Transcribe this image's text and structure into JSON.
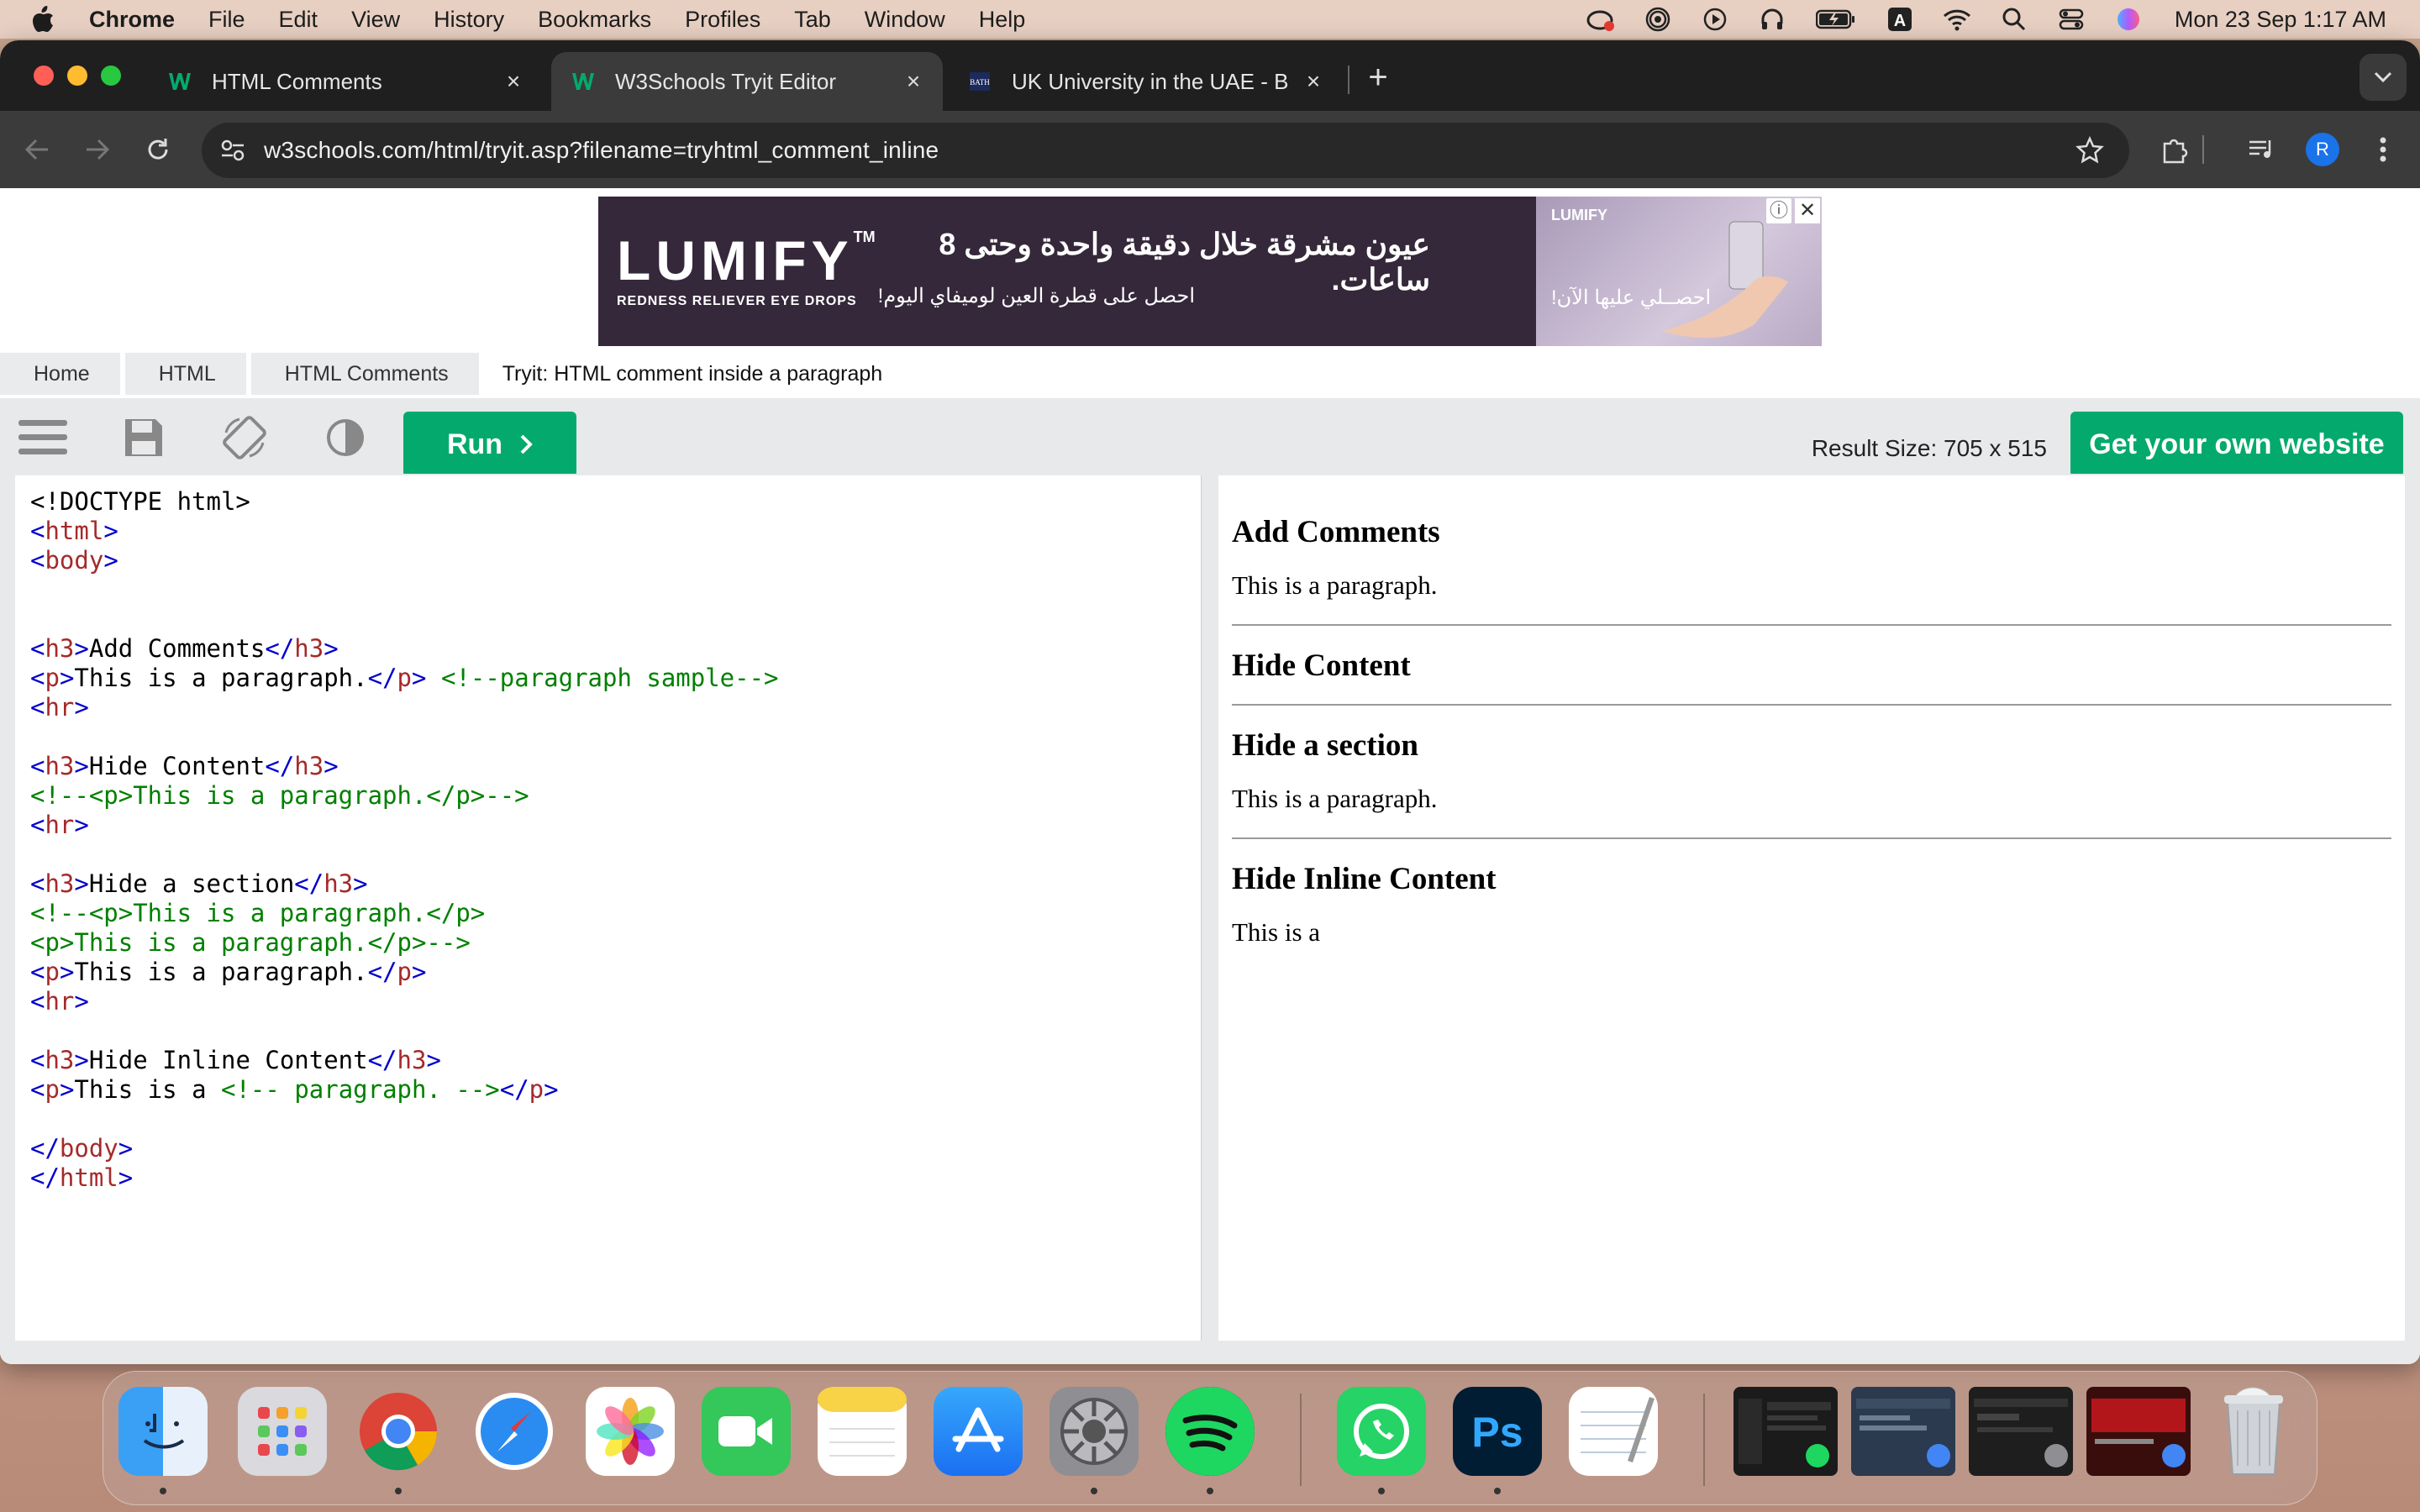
{
  "menubar": {
    "app": "Chrome",
    "items": [
      "File",
      "Edit",
      "View",
      "History",
      "Bookmarks",
      "Profiles",
      "Tab",
      "Window",
      "Help"
    ],
    "clock": "Mon 23 Sep  1:17 AM",
    "status_icons": [
      "creative-cloud-icon",
      "airdrop-icon",
      "play-icon",
      "headphones-icon",
      "battery-icon",
      "keyboard-a-icon",
      "wifi-icon",
      "spotlight-icon",
      "control-center-icon",
      "siri-icon"
    ]
  },
  "browser": {
    "tabs": [
      {
        "title": "HTML Comments",
        "icon": "w3schools-icon"
      },
      {
        "title": "W3Schools Tryit Editor",
        "icon": "w3schools-icon"
      },
      {
        "title": "UK University in the UAE - Ba",
        "icon": "bath-spa-icon"
      }
    ],
    "url": "w3schools.com/html/tryit.asp?filename=tryhtml_comment_inline",
    "avatar_letter": "R"
  },
  "ad": {
    "brand": "LUMIFY",
    "tm": "TM",
    "tagline": "REDNESS RELIEVER EYE DROPS",
    "headline": "عيون مشرقة خلال دقيقة واحدة وحتى 8 ساعات.",
    "subline": "احصل على قطرة العين لوميفاي اليوم!",
    "cta": "احصــلي عليها الآن!",
    "info": "ⓘ",
    "close": "✕"
  },
  "breadcrumb": [
    "Home",
    "HTML",
    "HTML Comments",
    "Tryit: HTML comment inside a paragraph"
  ],
  "editor": {
    "run_label": "Run",
    "result_size": "Result Size: 705 x 515",
    "get_website": "Get your own website",
    "accent": "#04aa6d"
  },
  "result": {
    "h1": "Add Comments",
    "p1": "This is a paragraph.",
    "h2": "Hide Content",
    "h3": "Hide a section",
    "p3": "This is a paragraph.",
    "h4": "Hide Inline Content",
    "p4": "This is a"
  },
  "code_lines": [
    [
      {
        "c": "dt",
        "t": "<!DOCTYPE html>"
      }
    ],
    [
      {
        "c": "br",
        "t": "<"
      },
      {
        "c": "tg",
        "t": "html"
      },
      {
        "c": "br",
        "t": ">"
      }
    ],
    [
      {
        "c": "br",
        "t": "<"
      },
      {
        "c": "tg",
        "t": "body"
      },
      {
        "c": "br",
        "t": ">"
      }
    ],
    [],
    [],
    [
      {
        "c": "br",
        "t": "<"
      },
      {
        "c": "tg",
        "t": "h3"
      },
      {
        "c": "br",
        "t": ">"
      },
      {
        "c": "dt",
        "t": "Add Comments"
      },
      {
        "c": "br",
        "t": "</"
      },
      {
        "c": "tg",
        "t": "h3"
      },
      {
        "c": "br",
        "t": ">"
      }
    ],
    [
      {
        "c": "br",
        "t": "<"
      },
      {
        "c": "tg",
        "t": "p"
      },
      {
        "c": "br",
        "t": ">"
      },
      {
        "c": "dt",
        "t": "This is a paragraph."
      },
      {
        "c": "br",
        "t": "</"
      },
      {
        "c": "tg",
        "t": "p"
      },
      {
        "c": "br",
        "t": ">"
      },
      {
        "c": "dt",
        "t": " "
      },
      {
        "c": "cm",
        "t": "<!--paragraph sample-->"
      }
    ],
    [
      {
        "c": "br",
        "t": "<"
      },
      {
        "c": "tg",
        "t": "hr"
      },
      {
        "c": "br",
        "t": ">"
      }
    ],
    [],
    [
      {
        "c": "br",
        "t": "<"
      },
      {
        "c": "tg",
        "t": "h3"
      },
      {
        "c": "br",
        "t": ">"
      },
      {
        "c": "dt",
        "t": "Hide Content"
      },
      {
        "c": "br",
        "t": "</"
      },
      {
        "c": "tg",
        "t": "h3"
      },
      {
        "c": "br",
        "t": ">"
      }
    ],
    [
      {
        "c": "cm",
        "t": "<!--<p>This is a paragraph.</p>-->"
      }
    ],
    [
      {
        "c": "br",
        "t": "<"
      },
      {
        "c": "tg",
        "t": "hr"
      },
      {
        "c": "br",
        "t": ">"
      }
    ],
    [],
    [
      {
        "c": "br",
        "t": "<"
      },
      {
        "c": "tg",
        "t": "h3"
      },
      {
        "c": "br",
        "t": ">"
      },
      {
        "c": "dt",
        "t": "Hide a section"
      },
      {
        "c": "br",
        "t": "</"
      },
      {
        "c": "tg",
        "t": "h3"
      },
      {
        "c": "br",
        "t": ">"
      }
    ],
    [
      {
        "c": "cm",
        "t": "<!--<p>This is a paragraph.</p>"
      }
    ],
    [
      {
        "c": "cm",
        "t": "<p>This is a paragraph.</p>-->"
      }
    ],
    [
      {
        "c": "br",
        "t": "<"
      },
      {
        "c": "tg",
        "t": "p"
      },
      {
        "c": "br",
        "t": ">"
      },
      {
        "c": "dt",
        "t": "This is a paragraph."
      },
      {
        "c": "br",
        "t": "</"
      },
      {
        "c": "tg",
        "t": "p"
      },
      {
        "c": "br",
        "t": ">"
      }
    ],
    [
      {
        "c": "br",
        "t": "<"
      },
      {
        "c": "tg",
        "t": "hr"
      },
      {
        "c": "br",
        "t": ">"
      }
    ],
    [],
    [
      {
        "c": "br",
        "t": "<"
      },
      {
        "c": "tg",
        "t": "h3"
      },
      {
        "c": "br",
        "t": ">"
      },
      {
        "c": "dt",
        "t": "Hide Inline Content"
      },
      {
        "c": "br",
        "t": "</"
      },
      {
        "c": "tg",
        "t": "h3"
      },
      {
        "c": "br",
        "t": ">"
      }
    ],
    [
      {
        "c": "br",
        "t": "<"
      },
      {
        "c": "tg",
        "t": "p"
      },
      {
        "c": "br",
        "t": ">"
      },
      {
        "c": "dt",
        "t": "This is a "
      },
      {
        "c": "cm",
        "t": "<!-- paragraph. -->"
      },
      {
        "c": "br",
        "t": "</"
      },
      {
        "c": "tg",
        "t": "p"
      },
      {
        "c": "br",
        "t": ">"
      }
    ],
    [],
    [
      {
        "c": "br",
        "t": "</"
      },
      {
        "c": "tg",
        "t": "body"
      },
      {
        "c": "br",
        "t": ">"
      }
    ],
    [
      {
        "c": "br",
        "t": "</"
      },
      {
        "c": "tg",
        "t": "html"
      },
      {
        "c": "br",
        "t": ">"
      }
    ]
  ],
  "dock": [
    "finder",
    "launchpad",
    "chrome",
    "safari",
    "photos",
    "facetime",
    "notes",
    "app-store",
    "system-settings",
    "spotify",
    "whatsapp",
    "photoshop",
    "textedit",
    "window-spotify",
    "window-chrome-1",
    "window-system",
    "window-chrome-2",
    "trash"
  ]
}
